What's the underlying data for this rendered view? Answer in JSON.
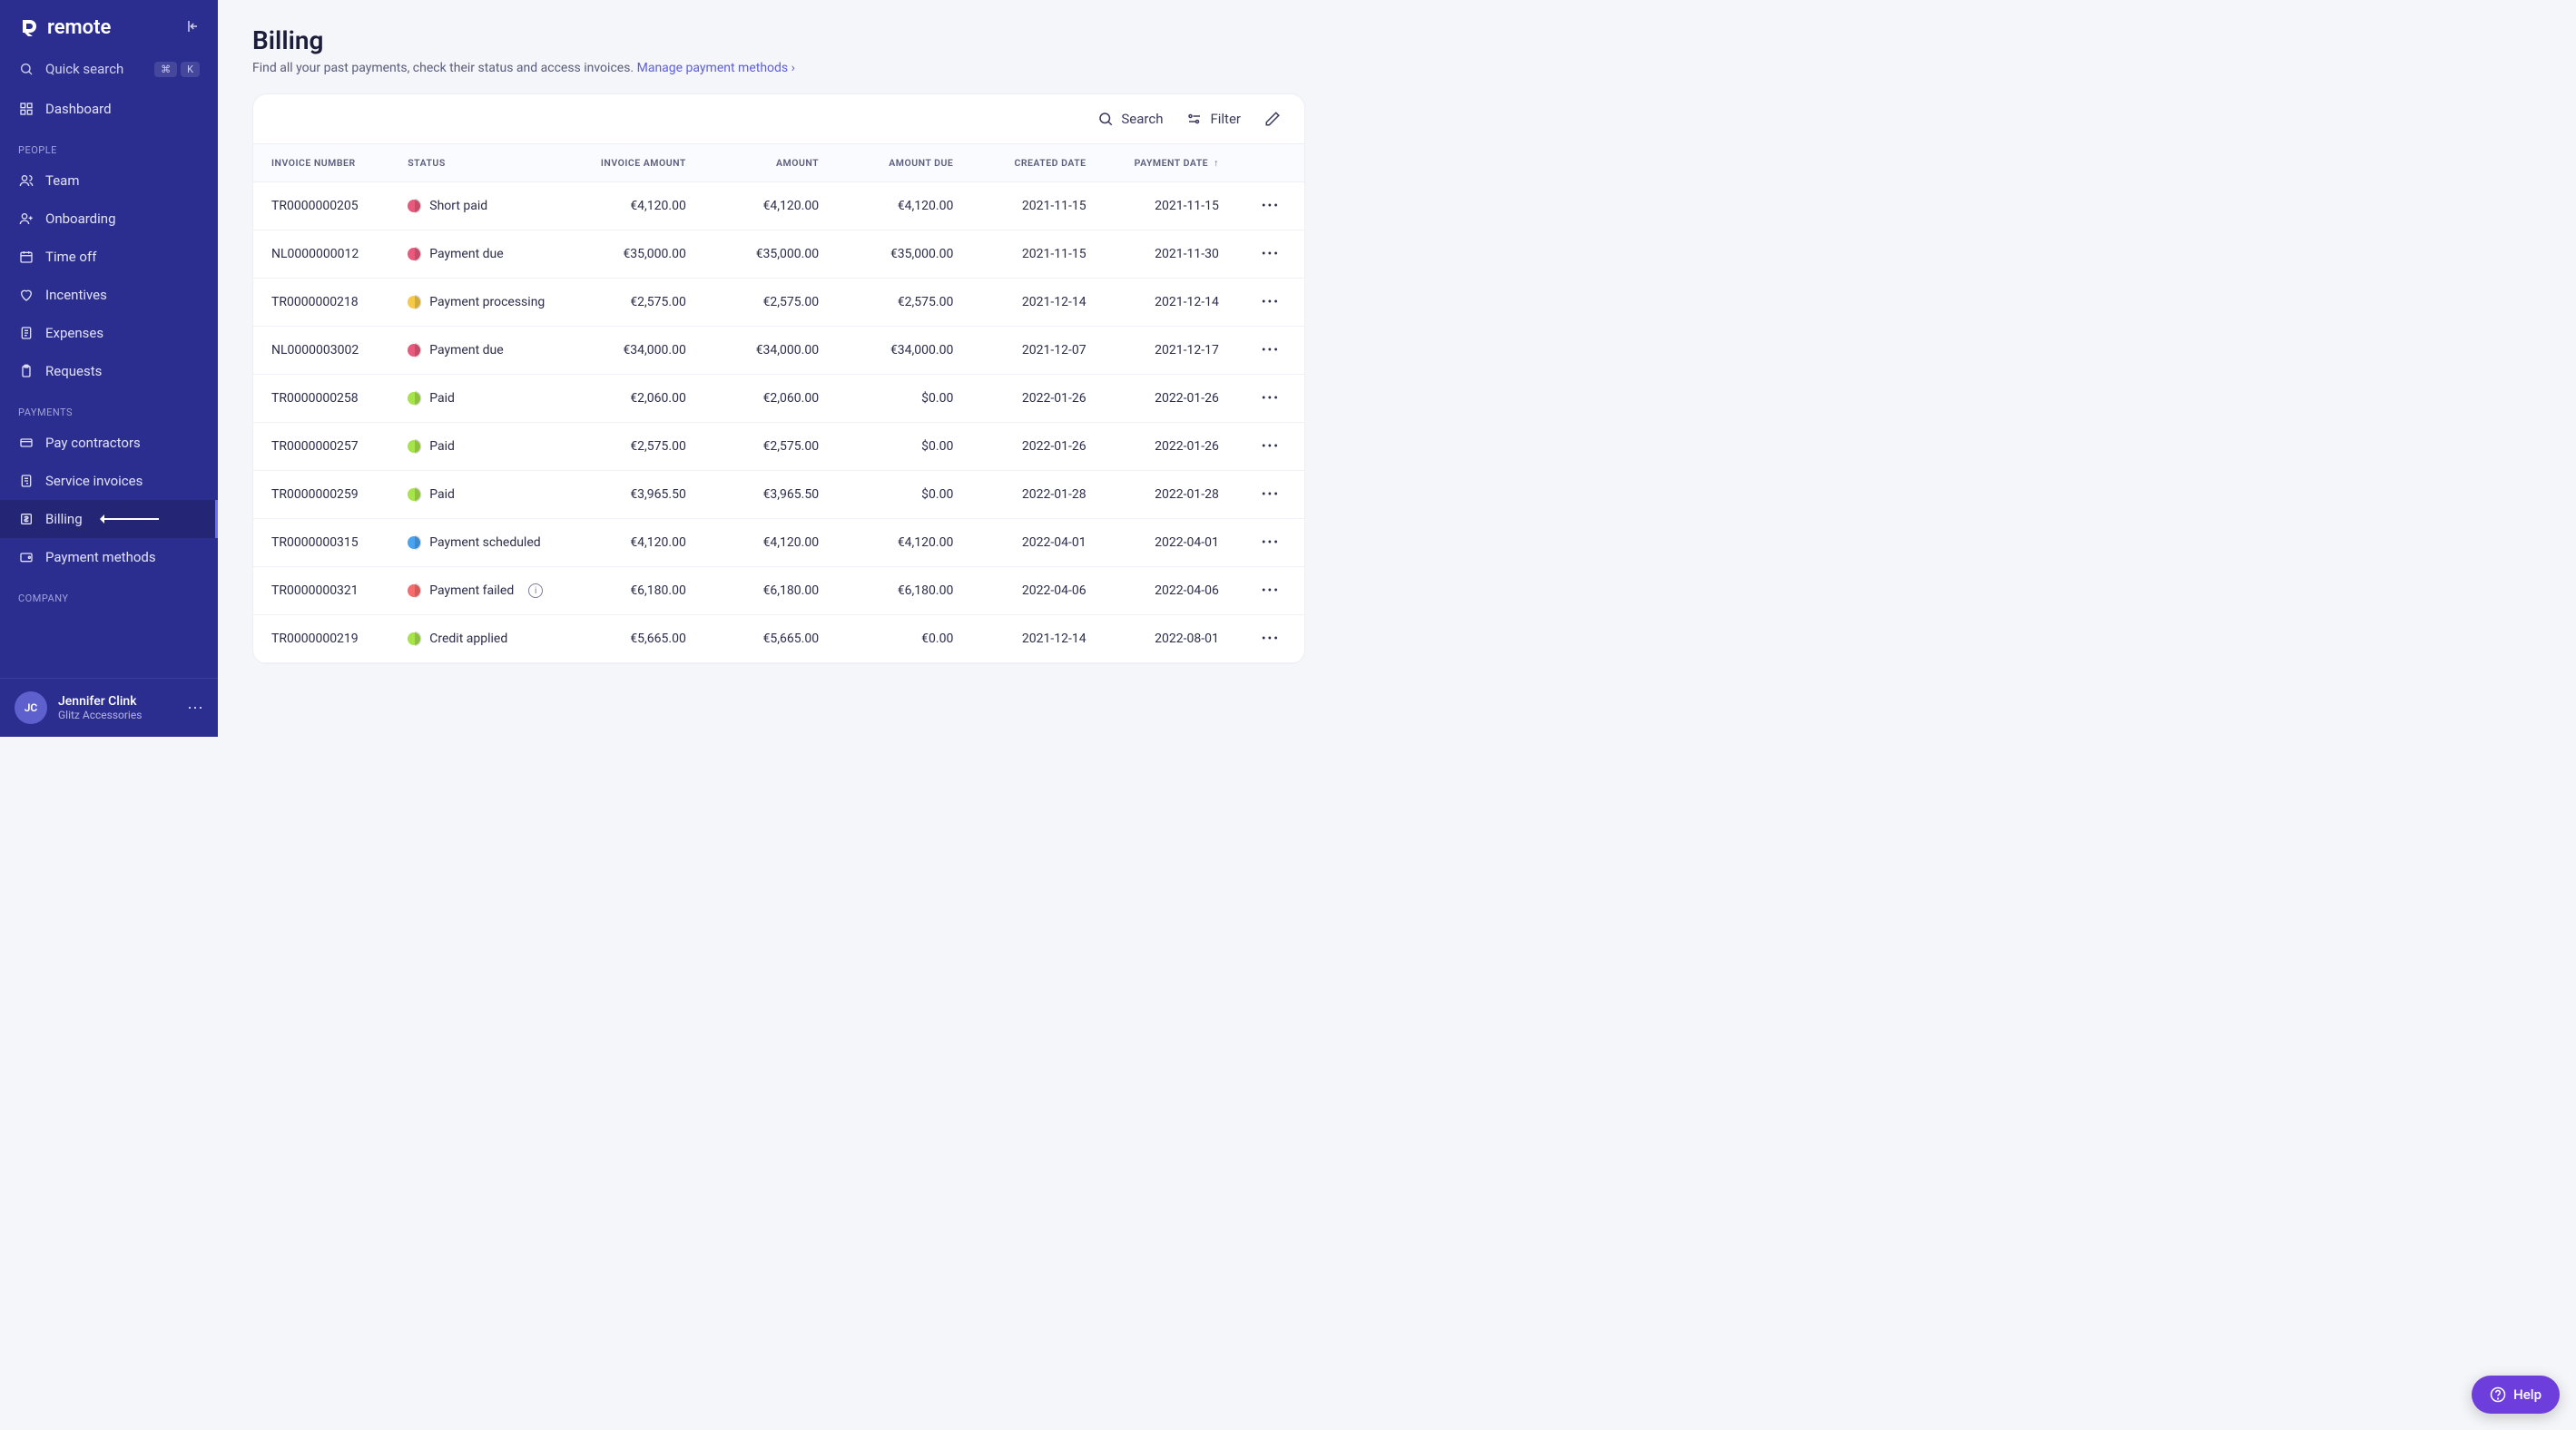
{
  "brand": "remote",
  "quick_search": {
    "label": "Quick search",
    "keys": [
      "⌘",
      "K"
    ]
  },
  "sidebar": {
    "dashboard": "Dashboard",
    "sections": [
      {
        "title": "PEOPLE",
        "items": [
          {
            "icon": "users-icon",
            "label": "Team"
          },
          {
            "icon": "user-plus-icon",
            "label": "Onboarding"
          },
          {
            "icon": "calendar-icon",
            "label": "Time off"
          },
          {
            "icon": "heart-icon",
            "label": "Incentives"
          },
          {
            "icon": "receipt-icon",
            "label": "Expenses"
          },
          {
            "icon": "clipboard-icon",
            "label": "Requests"
          }
        ]
      },
      {
        "title": "PAYMENTS",
        "items": [
          {
            "icon": "card-icon",
            "label": "Pay contractors"
          },
          {
            "icon": "invoice-icon",
            "label": "Service invoices"
          },
          {
            "icon": "dollar-icon",
            "label": "Billing",
            "active": true,
            "arrow": true
          },
          {
            "icon": "wallet-icon",
            "label": "Payment methods"
          }
        ]
      },
      {
        "title": "COMPANY",
        "items": []
      }
    ]
  },
  "user": {
    "initials": "JC",
    "name": "Jennifer Clink",
    "sub": "Glitz Accessories"
  },
  "page": {
    "title": "Billing",
    "sub": "Find all your past payments, check their status and access invoices.",
    "link_label": "Manage payment methods"
  },
  "toolbar": {
    "search": "Search",
    "filter": "Filter"
  },
  "columns": [
    "INVOICE NUMBER",
    "STATUS",
    "INVOICE AMOUNT",
    "AMOUNT",
    "AMOUNT DUE",
    "CREATED DATE",
    "PAYMENT DATE"
  ],
  "sort_col_index": 6,
  "status_colors": {
    "Short paid": "#e75a7c",
    "Payment due": "#e75a7c",
    "Payment processing": "#f7c948",
    "Paid": "#a7e34b",
    "Payment scheduled": "#4aa3f0",
    "Payment failed": "#f76c6c",
    "Credit applied": "#a7e34b"
  },
  "rows": [
    {
      "inv": "TR0000000205",
      "status": "Short paid",
      "ia": "€4,120.00",
      "a": "€4,120.00",
      "due": "€4,120.00",
      "cd": "2021-11-15",
      "pd": "2021-11-15"
    },
    {
      "inv": "NL0000000012",
      "status": "Payment due",
      "ia": "€35,000.00",
      "a": "€35,000.00",
      "due": "€35,000.00",
      "cd": "2021-11-15",
      "pd": "2021-11-30"
    },
    {
      "inv": "TR0000000218",
      "status": "Payment processing",
      "ia": "€2,575.00",
      "a": "€2,575.00",
      "due": "€2,575.00",
      "cd": "2021-12-14",
      "pd": "2021-12-14"
    },
    {
      "inv": "NL0000003002",
      "status": "Payment due",
      "ia": "€34,000.00",
      "a": "€34,000.00",
      "due": "€34,000.00",
      "cd": "2021-12-07",
      "pd": "2021-12-17"
    },
    {
      "inv": "TR0000000258",
      "status": "Paid",
      "ia": "€2,060.00",
      "a": "€2,060.00",
      "due": "$0.00",
      "cd": "2022-01-26",
      "pd": "2022-01-26"
    },
    {
      "inv": "TR0000000257",
      "status": "Paid",
      "ia": "€2,575.00",
      "a": "€2,575.00",
      "due": "$0.00",
      "cd": "2022-01-26",
      "pd": "2022-01-26"
    },
    {
      "inv": "TR0000000259",
      "status": "Paid",
      "ia": "€3,965.50",
      "a": "€3,965.50",
      "due": "$0.00",
      "cd": "2022-01-28",
      "pd": "2022-01-28"
    },
    {
      "inv": "TR0000000315",
      "status": "Payment scheduled",
      "ia": "€4,120.00",
      "a": "€4,120.00",
      "due": "€4,120.00",
      "cd": "2022-04-01",
      "pd": "2022-04-01"
    },
    {
      "inv": "TR0000000321",
      "status": "Payment failed",
      "info": true,
      "ia": "€6,180.00",
      "a": "€6,180.00",
      "due": "€6,180.00",
      "cd": "2022-04-06",
      "pd": "2022-04-06"
    },
    {
      "inv": "TR0000000219",
      "status": "Credit applied",
      "ia": "€5,665.00",
      "a": "€5,665.00",
      "due": "€0.00",
      "cd": "2021-12-14",
      "pd": "2022-08-01"
    }
  ],
  "help": "Help"
}
